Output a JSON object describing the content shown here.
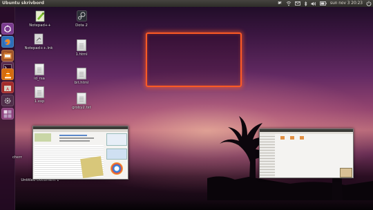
{
  "panel": {
    "title": "Ubuntu skrivbord",
    "clock": "sun nov 3 20:23",
    "tray_icons": [
      "dropbox-icon",
      "network-icon",
      "mail-icon",
      "bluetooth-icon",
      "volume-icon",
      "battery-icon",
      "power-icon"
    ]
  },
  "launcher": {
    "items": [
      "dash-icon",
      "firefox-icon",
      "files-icon",
      "terminal-icon",
      "vlc-icon",
      "software-center-icon",
      "settings-icon",
      "workspace-icon"
    ]
  },
  "desktop": {
    "icons": [
      {
        "label": "Notepad++",
        "type": "app"
      },
      {
        "label": "Notepad++.lnk",
        "type": "file"
      },
      {
        "label": "id_rsa",
        "type": "file"
      },
      {
        "label": "1.exp",
        "type": "file"
      },
      {
        "label": "Dota 2",
        "type": "app"
      },
      {
        "label": "1.html",
        "type": "file"
      },
      {
        "label": "bit.html",
        "type": "file"
      },
      {
        "label": "groby2.txt",
        "type": "file"
      },
      {
        "label": "cherr",
        "type": "file"
      },
      {
        "label": "Untitled Document 1",
        "type": "file"
      }
    ]
  },
  "colors": {
    "selection": "#ff5a24",
    "panel": "#3c3b37"
  }
}
